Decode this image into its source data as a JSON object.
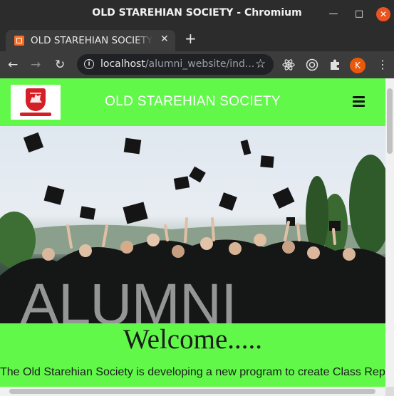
{
  "window": {
    "title": "OLD STAREHIAN SOCIETY - Chromium",
    "minimize_symbol": "—",
    "maximize_symbol": "□",
    "close_symbol": "✕"
  },
  "tabs": [
    {
      "label": "OLD STAREHIAN SOCIETY",
      "close_symbol": "✕",
      "favicon": "xampp-icon"
    }
  ],
  "new_tab_symbol": "+",
  "toolbar": {
    "back_symbol": "←",
    "forward_symbol": "→",
    "reload_symbol": "↻",
    "url_host": "localhost",
    "url_path": "/alumni_website/ind...",
    "bookmark_symbol": "☆",
    "profile_initial": "K"
  },
  "page": {
    "brand": "OLD STAREHIAN SOCIETY",
    "hero_text": "ALUMNI",
    "welcome_heading": "Welcome.....",
    "intro_text": "The Old Starehian Society is developing a new program to create Class Representatives who serve as liaisons between ... The class is"
  },
  "colors": {
    "navbar_bg": "#61f84a",
    "content_bg": "#61f84a",
    "logo_red": "#d41f26",
    "close_button": "#e95420",
    "avatar": "#e8590c"
  }
}
